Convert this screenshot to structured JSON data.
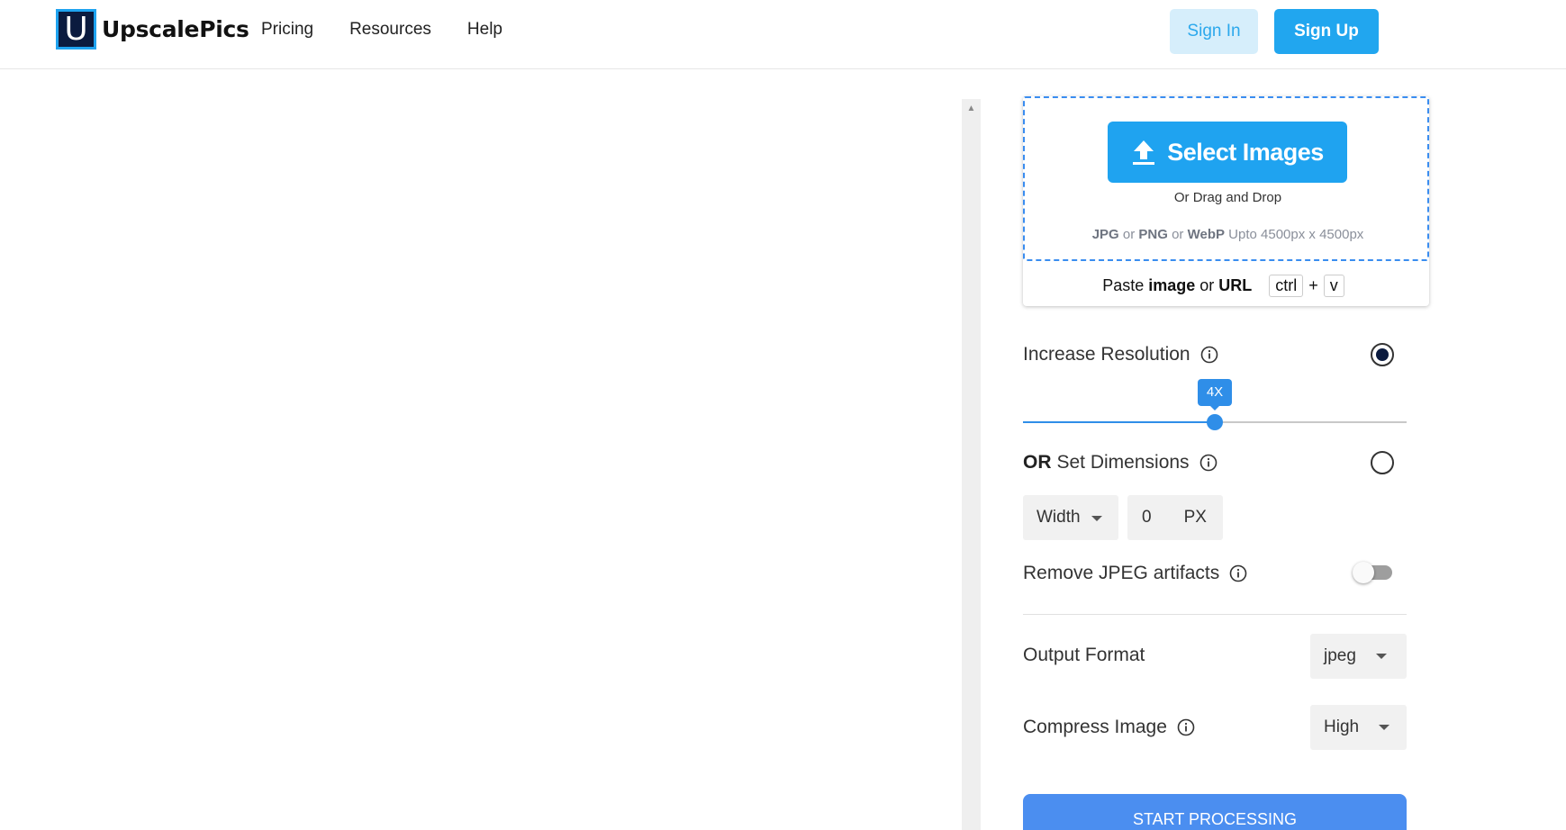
{
  "header": {
    "logo_letter": "U",
    "logo_text": "UpscalePics",
    "nav": [
      "Pricing",
      "Resources",
      "Help"
    ],
    "sign_in": "Sign In",
    "sign_up": "Sign Up"
  },
  "upload": {
    "select_label": "Select Images",
    "drag_drop": "Or Drag and Drop",
    "formats": {
      "jpg": "JPG",
      "or1": " or ",
      "png": "PNG",
      "or2": " or ",
      "webp": "WebP",
      "limit": " Upto 4500px x 4500px"
    },
    "paste": {
      "prefix": "Paste",
      "image": "image",
      "or": "or",
      "url": "URL",
      "key1": "ctrl",
      "plus": "+",
      "key2": "v"
    }
  },
  "options": {
    "increase_resolution": {
      "label": "Increase Resolution",
      "selected": true,
      "scale_label": "4X",
      "scale_fraction": 0.5
    },
    "set_dimensions": {
      "or_label": "OR",
      "label": "Set Dimensions",
      "selected": false,
      "dimension": "Width",
      "value": "0",
      "unit": "PX"
    },
    "remove_jpeg_artifacts": {
      "label": "Remove JPEG artifacts",
      "enabled": false
    },
    "output_format": {
      "label": "Output Format",
      "value": "jpeg"
    },
    "compress_image": {
      "label": "Compress Image",
      "value": "High"
    },
    "start_button": "START PROCESSING"
  },
  "colors": {
    "brand_blue": "#1fa3f0",
    "slider_blue": "#2f8ee8",
    "start_blue": "#4b8ef0",
    "logo_navy": "#0b1b3f"
  }
}
